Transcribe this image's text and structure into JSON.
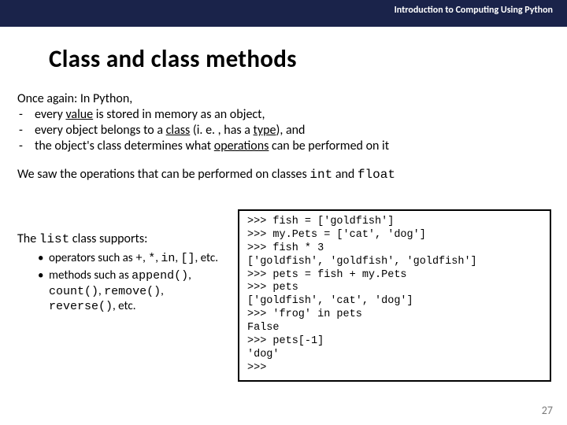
{
  "header": {
    "course": "Introduction to Computing Using Python"
  },
  "title": "Class and  class methods",
  "intro": {
    "lead": "Once again: In Python,",
    "bullets": [
      {
        "pre": "every ",
        "u": "value",
        "post": " is stored in memory as an object,"
      },
      {
        "pre": "every object belongs to a ",
        "u": "class",
        "post": " (i. e. , has a ",
        "u2": "type",
        "post2": "), and"
      },
      {
        "pre": "the object's class determines what ",
        "u": "operations",
        "post": " can be performed on it"
      }
    ]
  },
  "para2": {
    "pre": "We saw the operations that can be performed on classes ",
    "m1": "int",
    "mid": " and ",
    "m2": "float"
  },
  "left": {
    "supports_pre": "The ",
    "supports_mono": "list",
    "supports_post": " class supports:",
    "items": [
      {
        "pre": "operators such as ",
        "mono": "+",
        "mid1": ", ",
        "mono2": "*",
        "mid2": ", ",
        "mono3": "in",
        "mid3": ", ",
        "mono4": "[]",
        "post": ", etc."
      },
      {
        "pre": "methods such as ",
        "mono": "append()",
        "mid1": ", ",
        "mono2": "count()",
        "mid2": ", ",
        "mono3": "remove()",
        "mid3": ", ",
        "mono4": "reverse()",
        "post": ", etc."
      }
    ]
  },
  "code": {
    "l1": ">>> fish = ['goldfish']",
    "l2": ">>> my.Pets = ['cat', 'dog']",
    "l3": ">>> fish * 3",
    "l4": "['goldfish', 'goldfish', 'goldfish']",
    "l5": ">>> pets = fish + my.Pets",
    "l6": ">>> pets",
    "l7": "['goldfish', 'cat', 'dog']",
    "l8": ">>> 'frog' in pets",
    "l9": "False",
    "l10": ">>> pets[-1]",
    "l11": "'dog'",
    "l12": ">>> "
  },
  "page_number": "27"
}
